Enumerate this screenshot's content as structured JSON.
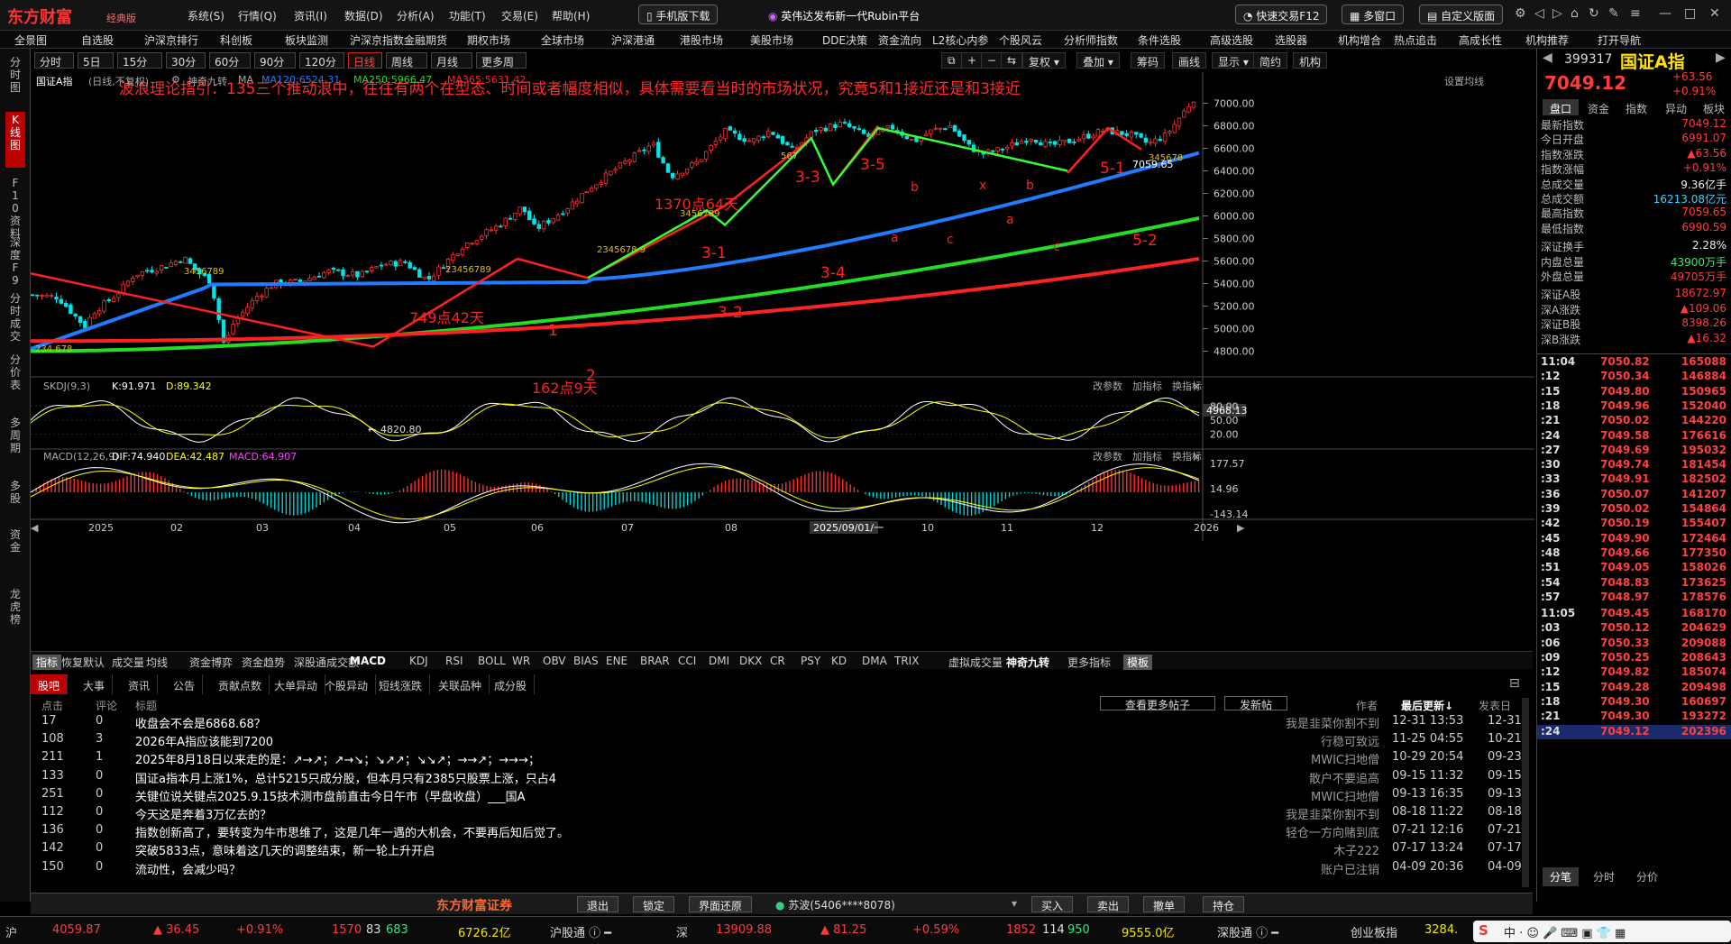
{
  "app": {
    "name": "东方财富",
    "edition": "经典版"
  },
  "menu": [
    "系统(S)",
    "行情(Q)",
    "资讯(I)",
    "数据(D)",
    "分析(A)",
    "功能(T)",
    "交易(E)",
    "帮助(H)"
  ],
  "topbar": {
    "mobile_btn": "手机版下载",
    "news": "英伟达发布新一代Rubin平台",
    "quick_trade": "快速交易F12",
    "multi_window": "多窗口",
    "custom_layout": "自定义版面"
  },
  "nav": [
    "全景图",
    "自选股",
    "沪深京排行",
    "科创板",
    "板块监测",
    "沪深京指数",
    "金融期货",
    "期权市场",
    "全球市场",
    "沪深港通",
    "港股市场",
    "美股市场",
    "DDE决策",
    "资金流向",
    "L2核心内参",
    "个股风云",
    "分析师指数",
    "条件选股",
    "高级选股",
    "选股器",
    "机构增合",
    "热点追击",
    "高成长性",
    "机构推荐",
    "打开导航"
  ],
  "left_tabs": [
    "分时图",
    "K线图",
    "F10资料",
    "深度F9",
    "分时成交",
    "分价表",
    "多周期",
    "多股",
    "资金",
    "龙虎榜"
  ],
  "periods": [
    "分时",
    "5日",
    "15分钟",
    "30分钟",
    "60分钟",
    "90分钟",
    "120分钟",
    "日线",
    "周线",
    "月线",
    "更多周期"
  ],
  "right_tools": [
    "复权",
    "叠加",
    "筹码",
    "画线",
    "显示",
    "简约",
    "机构"
  ],
  "chart_info": {
    "name": "国证A指",
    "mode": "(日线,不复权)",
    "indicator": "神奇九转",
    "ma120": "MA120:6524.31",
    "ma250": "MA250:5966.47",
    "ma365": "MA365:5631.42",
    "settings": "设置均线"
  },
  "annotation": "波浪理论指引：135三个推动浪中，往往有两个在型态、时间或者幅度相似，具体需要看当时的市场状况，究竟5和1接近还是和3接近",
  "wave_labels": {
    "w1": "1",
    "w2": "2",
    "w31": "3-1",
    "w32": "3-2",
    "w33": "3-3",
    "w34": "3-4",
    "w35": "3-5",
    "w51": "5-1",
    "w52": "5-2",
    "a": "a",
    "b": "b",
    "c": "c",
    "x": "x",
    "d749": "749点42天",
    "d162": "162点9天",
    "d1370": "1370点64天",
    "low": "4820.80",
    "high": "7059.65",
    "cur": "4968.13"
  },
  "price_axis": [
    "7000.00",
    "6800.00",
    "6600.00",
    "6400.00",
    "6200.00",
    "6000.00",
    "5800.00",
    "5600.00",
    "5400.00",
    "5200.00",
    "5000.00",
    "4800.00"
  ],
  "kdj": {
    "title": "SKDJ(9,3)",
    "k": "K:91.971",
    "d": "D:89.342",
    "axis": [
      "80.00",
      "50.00",
      "20.00"
    ],
    "ctrl": [
      "改参数",
      "加指标",
      "换指标"
    ]
  },
  "macd": {
    "title": "MACD(12,26,9)",
    "dif": "DIF:74.940",
    "dea": "DEA:42.487",
    "macd": "MACD:64.907",
    "axis": [
      "177.57",
      "14.96",
      "-143.14"
    ]
  },
  "x_axis": [
    "2025",
    "02",
    "03",
    "04",
    "05",
    "06",
    "07",
    "08",
    "2025/09/01/一",
    "10",
    "11",
    "12",
    "2026"
  ],
  "indicator_bar": [
    "指标",
    "恢复默认",
    "成交量",
    "均线",
    "资金博弈",
    "资金趋势",
    "深股通成交额",
    "MACD",
    "KDJ",
    "RSI",
    "BOLL",
    "WR",
    "OBV",
    "BIAS",
    "ENE",
    "BRAR",
    "CCI",
    "DMI",
    "DKX",
    "CR",
    "PSY",
    "KD",
    "DMA",
    "TRIX",
    "虚拟成交量",
    "神奇九转",
    "更多指标",
    "模板"
  ],
  "quote": {
    "code": "399317",
    "name": "国证A指",
    "price": "7049.12",
    "change": "+63.56",
    "pct": "+0.91%",
    "tabs": [
      "盘口",
      "资金",
      "指数",
      "异动",
      "板块"
    ]
  },
  "quote_rows": [
    {
      "k": "最新指数",
      "v": "7049.12",
      "c": "red"
    },
    {
      "k": "今日开盘",
      "v": "6991.07",
      "c": "red"
    },
    {
      "k": "指数涨跌",
      "v": "▲63.56",
      "c": "red"
    },
    {
      "k": "指数涨幅",
      "v": "+0.91%",
      "c": "red"
    },
    {
      "k": "总成交量",
      "v": "9.36亿手",
      "c": "white"
    },
    {
      "k": "总成交额",
      "v": "16213.08亿元",
      "c": "cyan"
    },
    {
      "k": "最高指数",
      "v": "7059.65",
      "c": "red"
    },
    {
      "k": "最低指数",
      "v": "6990.59",
      "c": "red"
    },
    {
      "k": "深证换手",
      "v": "2.28%",
      "c": "white"
    },
    {
      "k": "内盘总量",
      "v": "43900万手",
      "c": "green"
    },
    {
      "k": "外盘总量",
      "v": "49705万手",
      "c": "red"
    },
    {
      "k": "深证A股",
      "v": "18672.97",
      "c": "red"
    },
    {
      "k": "深A涨跌",
      "v": "▲109.06",
      "c": "red"
    },
    {
      "k": "深证B股",
      "v": "8398.26",
      "c": "red"
    },
    {
      "k": "深B涨跌",
      "v": "▲16.32",
      "c": "red"
    }
  ],
  "ticks": [
    {
      "t": "11:04",
      "p": "7050.82",
      "q": "165088"
    },
    {
      "t": ":12",
      "p": "7050.34",
      "q": "146884"
    },
    {
      "t": ":15",
      "p": "7049.80",
      "q": "150965"
    },
    {
      "t": ":18",
      "p": "7049.96",
      "q": "152040"
    },
    {
      "t": ":21",
      "p": "7050.02",
      "q": "144220"
    },
    {
      "t": ":24",
      "p": "7049.58",
      "q": "176616"
    },
    {
      "t": ":27",
      "p": "7049.69",
      "q": "195032"
    },
    {
      "t": ":30",
      "p": "7049.74",
      "q": "181454"
    },
    {
      "t": ":33",
      "p": "7049.91",
      "q": "182502"
    },
    {
      "t": ":36",
      "p": "7050.07",
      "q": "141207"
    },
    {
      "t": ":39",
      "p": "7050.02",
      "q": "154864"
    },
    {
      "t": ":42",
      "p": "7050.19",
      "q": "155407"
    },
    {
      "t": ":45",
      "p": "7049.90",
      "q": "172464"
    },
    {
      "t": ":48",
      "p": "7049.66",
      "q": "177350"
    },
    {
      "t": ":51",
      "p": "7049.05",
      "q": "158026"
    },
    {
      "t": ":54",
      "p": "7048.83",
      "q": "173625"
    },
    {
      "t": ":57",
      "p": "7048.97",
      "q": "178576"
    },
    {
      "t": "11:05",
      "p": "7049.45",
      "q": "168170"
    },
    {
      "t": ":03",
      "p": "7050.12",
      "q": "204629"
    },
    {
      "t": ":06",
      "p": "7050.33",
      "q": "209088"
    },
    {
      "t": ":09",
      "p": "7050.25",
      "q": "208643"
    },
    {
      "t": ":12",
      "p": "7049.82",
      "q": "185074"
    },
    {
      "t": ":15",
      "p": "7049.28",
      "q": "209498"
    },
    {
      "t": ":18",
      "p": "7049.30",
      "q": "160697"
    },
    {
      "t": ":21",
      "p": "7049.30",
      "q": "193272"
    },
    {
      "t": ":24",
      "p": "7049.12",
      "q": "202396"
    }
  ],
  "tick_tabs": [
    "分笔",
    "分时",
    "分价"
  ],
  "forum": {
    "tabs": [
      "股吧",
      "大事",
      "资讯",
      "公告",
      "贡献点数",
      "大单异动",
      "个股异动",
      "短线涨跌",
      "关联品种",
      "成分股"
    ],
    "headers": [
      "点击",
      "评论",
      "标题",
      "作者",
      "最后更新↓",
      "发表日"
    ],
    "more": "查看更多帖子",
    "post": "发新帖",
    "rows": [
      {
        "clicks": "17",
        "comments": "0",
        "title": "收盘会不会是6868.68？",
        "author": "我是韭菜你割不到",
        "updated": "12-31 13:53",
        "date": "12-31"
      },
      {
        "clicks": "108",
        "comments": "3",
        "title": "2026年A指应该能到7200",
        "author": "行稳可致远",
        "updated": "11-25 04:55",
        "date": "10-21"
      },
      {
        "clicks": "211",
        "comments": "1",
        "title": "2025年8月18日以来走的是：↗→↗；↗→↘；↘↗↗；↘↘↗；→→↗；→→→；",
        "author": "MWIC扫地僧",
        "updated": "10-29 20:54",
        "date": "09-23"
      },
      {
        "clicks": "133",
        "comments": "0",
        "title": "国证a指本月上涨1%，总计5215只成分股，但本月只有2385只股票上涨，只占4",
        "author": "散户不要追高",
        "updated": "09-15 11:32",
        "date": "09-15"
      },
      {
        "clicks": "251",
        "comments": "0",
        "title": "关键位说关键点2025.9.15技术测市盘前直击今日午市（早盘收盘）___国A",
        "author": "MWIC扫地僧",
        "updated": "09-13 16:35",
        "date": "09-13"
      },
      {
        "clicks": "112",
        "comments": "0",
        "title": "今天这是奔着3万亿去的？",
        "author": "我是韭菜你割不到",
        "updated": "08-18 11:22",
        "date": "08-18"
      },
      {
        "clicks": "136",
        "comments": "0",
        "title": "指数创新高了，要转变为牛市思维了，这是几年一遇的大机会，不要再后知后觉了。",
        "author": "轻仓一方向赌到底",
        "updated": "07-21 12:16",
        "date": "07-21"
      },
      {
        "clicks": "142",
        "comments": "0",
        "title": "突破5833点，意味着这几天的调整结束，新一轮上升开启",
        "author": "木子222",
        "updated": "07-17 13:24",
        "date": "07-17"
      },
      {
        "clicks": "150",
        "comments": "0",
        "title": "流动性，会减少吗？",
        "author": "账户已注销",
        "updated": "04-09 20:36",
        "date": "04-09"
      }
    ]
  },
  "actions": {
    "brand": "东方财富证券",
    "exit": "退出",
    "lock": "锁定",
    "restore": "界面还原",
    "user": "苏波(5406****8078)",
    "buy": "买入",
    "sell": "卖出",
    "cancel": "撤单",
    "hold": "持仓"
  },
  "status": {
    "sh_idx": "4059.87",
    "sh_chg": "▲ 36.45",
    "sh_pct": "+0.91%",
    "sh_up": "1570",
    "sh_flat": "83",
    "sh_down": "683",
    "sh_amt": "6726.2亿",
    "hgt": "沪股通",
    "sz_label": "深",
    "sz_idx": "13909.88",
    "sz_chg": "▲ 81.25",
    "sz_pct": "+0.59%",
    "sz_up": "1852",
    "sz_flat": "114",
    "sz_down": "950",
    "sz_amt": "9555.0亿",
    "sgt": "深股通",
    "cyb": "创业板指",
    "cyb_idx": "3284.",
    "sh_label": "沪"
  },
  "chart_data": {
    "type": "candlestick",
    "title": "国证A指",
    "price_range": [
      4700,
      7100
    ],
    "key_points": {
      "low": 4820.8,
      "high": 7059.65,
      "last": 7049.12
    },
    "mas": {
      "MA120": 6524.31,
      "MA250": 5966.47,
      "MA365": 5631.42
    },
    "series_colors": {
      "MA120": "#1f7bff",
      "MA250": "#22dd22",
      "MA365": "#ff2222"
    },
    "kdj": {
      "K": 91.971,
      "D": 89.342
    },
    "macd": {
      "DIF": 74.94,
      "DEA": 42.487,
      "MACD": 64.907
    }
  }
}
